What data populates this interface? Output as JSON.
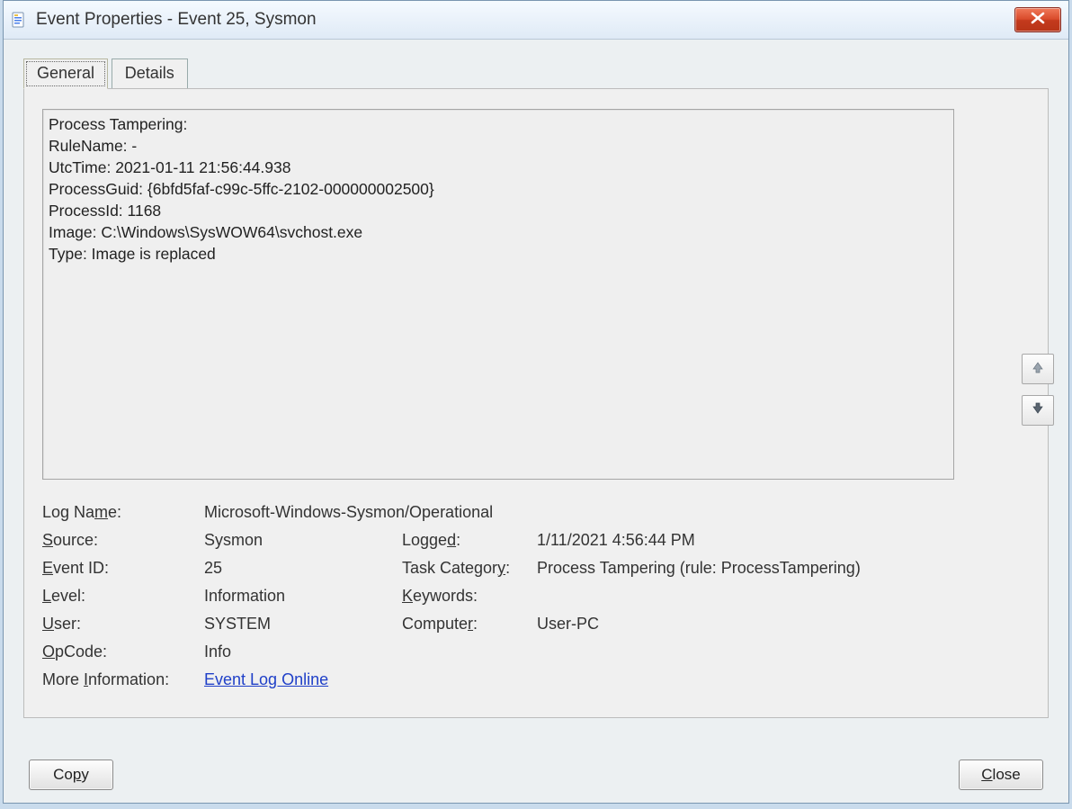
{
  "window": {
    "title": "Event Properties - Event 25, Sysmon"
  },
  "tabs": {
    "general": "General",
    "details": "Details"
  },
  "event_text": {
    "l0": "Process Tampering:",
    "l1": "RuleName: -",
    "l2": "UtcTime: 2021-01-11 21:56:44.938",
    "l3": "ProcessGuid: {6bfd5faf-c99c-5ffc-2102-000000002500}",
    "l4": "ProcessId: 1168",
    "l5": "Image: C:\\Windows\\SysWOW64\\svchost.exe",
    "l6": "Type: Image is replaced"
  },
  "props": {
    "log_name_label": "Log Name:",
    "log_name": "Microsoft-Windows-Sysmon/Operational",
    "source_label": "Source:",
    "source": "Sysmon",
    "logged_label": "Logged:",
    "logged": "1/11/2021 4:56:44 PM",
    "event_id_label": "Event ID:",
    "event_id": "25",
    "task_cat_label": "Task Category:",
    "task_cat": "Process Tampering (rule: ProcessTampering)",
    "level_label": "Level:",
    "level": "Information",
    "keywords_label": "Keywords:",
    "keywords": "",
    "user_label": "User:",
    "user": "SYSTEM",
    "computer_label": "Computer:",
    "computer": "User-PC",
    "opcode_label": "OpCode:",
    "opcode": "Info",
    "more_info_label": "More Information:",
    "more_info_link": "Event Log Online "
  },
  "buttons": {
    "copy": "Copy",
    "close": "Close"
  }
}
